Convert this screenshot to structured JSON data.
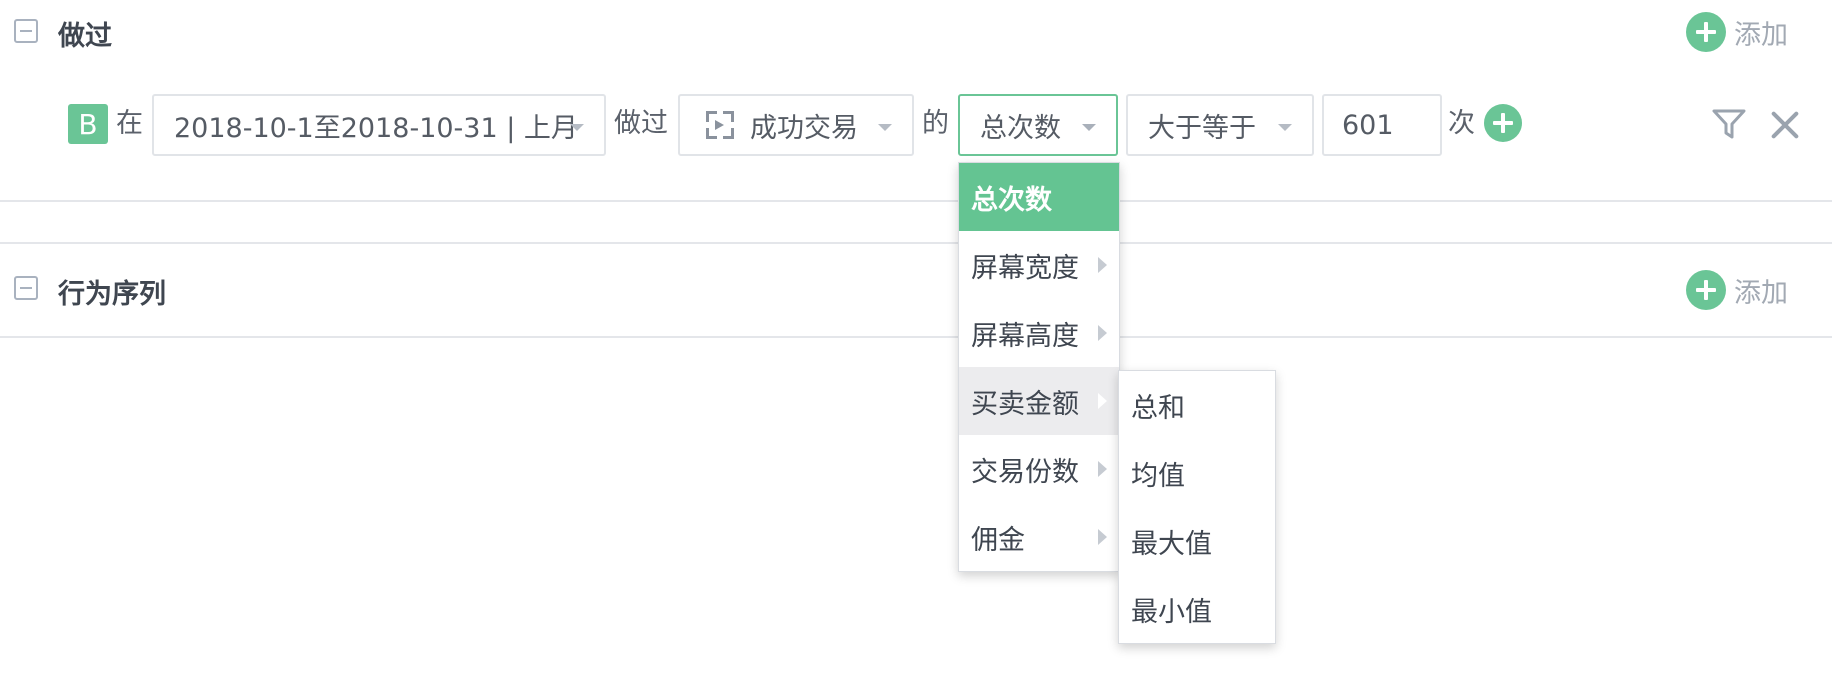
{
  "sections": {
    "done": {
      "title": "做过",
      "add_label": "添加"
    },
    "sequence": {
      "title": "行为序列",
      "add_label": "添加"
    }
  },
  "condition": {
    "badge": "B",
    "prefix": "在",
    "date_range": "2018-10-1至2018-10-31 | 上月",
    "did_label": "做过",
    "event": "成功交易",
    "of_label": "的",
    "metric": "总次数",
    "operator": "大于等于",
    "value": "601",
    "unit": "次"
  },
  "metric_menu": {
    "items": [
      {
        "label": "总次数",
        "state": "selected",
        "has_submenu": false
      },
      {
        "label": "屏幕宽度",
        "state": "normal",
        "has_submenu": true
      },
      {
        "label": "屏幕高度",
        "state": "normal",
        "has_submenu": true
      },
      {
        "label": "买卖金额",
        "state": "hover",
        "has_submenu": true
      },
      {
        "label": "交易份数",
        "state": "normal",
        "has_submenu": true
      },
      {
        "label": "佣金",
        "state": "normal",
        "has_submenu": true
      }
    ]
  },
  "aggregate_menu": {
    "items": [
      {
        "label": "总和"
      },
      {
        "label": "均值"
      },
      {
        "label": "最大值"
      },
      {
        "label": "最小值"
      }
    ]
  },
  "colors": {
    "accent": "#6ac596",
    "selected_bg": "#64c492",
    "hover_bg": "#ececee"
  },
  "icons": {
    "collapse": "minus-square-icon",
    "add": "plus-circle-icon",
    "event": "event-track-icon",
    "filter": "filter-icon",
    "close": "close-icon"
  }
}
